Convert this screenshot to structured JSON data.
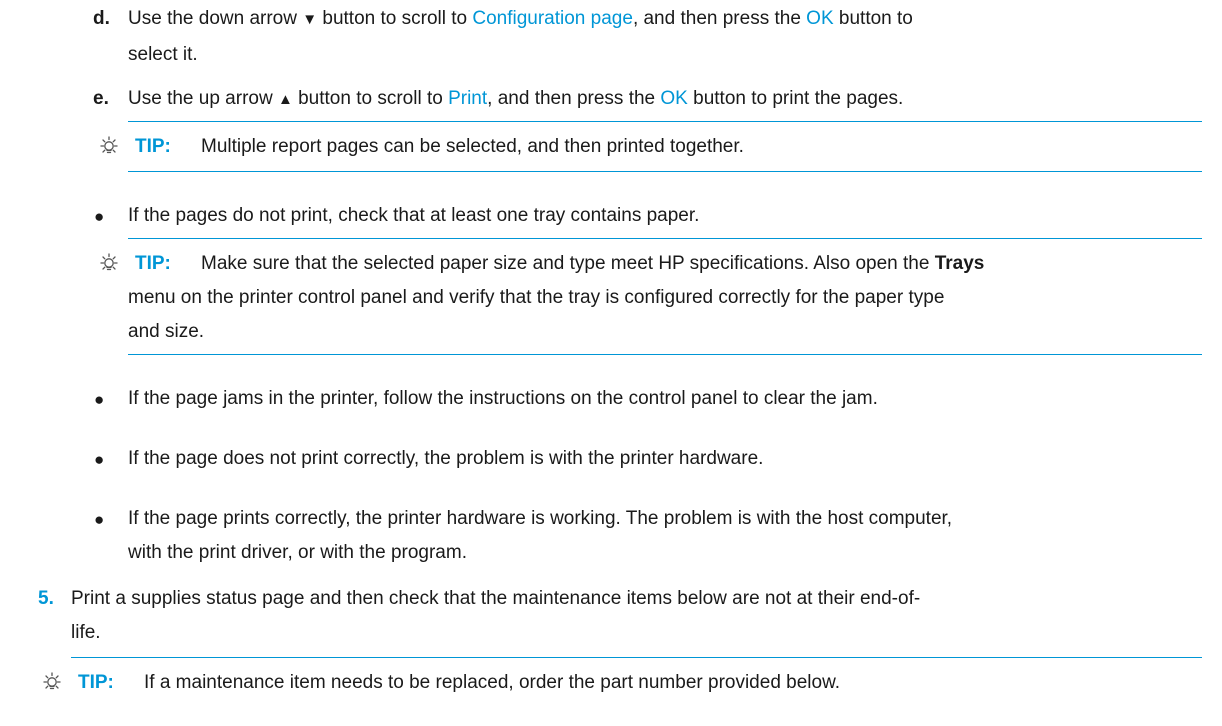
{
  "step_d": {
    "letter": "d.",
    "line1_a": "Use the down arrow ",
    "arrow": "▼",
    "line1_b": " button to scroll to ",
    "link1": "Configuration page",
    "line1_c": ", and then press the ",
    "link2": "OK",
    "line1_d": " button to",
    "line2": "select it."
  },
  "step_e": {
    "letter": "e.",
    "text_a": "Use the up arrow ",
    "arrow": "▲",
    "text_b": " button to scroll to ",
    "link1": "Print",
    "text_c": ", and then press the ",
    "link2": "OK",
    "text_d": " button to print the pages."
  },
  "tip1": {
    "label": "TIP:",
    "text": "Multiple report pages can be selected, and then printed together."
  },
  "bullet1": "If the pages do not print, check that at least one tray contains paper.",
  "tip2": {
    "label": "TIP:",
    "line1_a": "Make sure that the selected paper size and type meet HP specifications. Also open the ",
    "line1_bold": "Trays",
    "line2": "menu on the printer control panel and verify that the tray is configured correctly for the paper type",
    "line3": "and size."
  },
  "bullet2": "If the page jams in the printer, follow the instructions on the control panel to clear the jam.",
  "bullet3": "If the page does not print correctly, the problem is with the printer hardware.",
  "bullet4": {
    "line1": "If the page prints correctly, the printer hardware is working. The problem is with the host computer,",
    "line2": "with the print driver, or with the program."
  },
  "step5": {
    "number": "5.",
    "line1": "Print a supplies status page and then check that the maintenance items below are not at their end-of-",
    "line2": "life."
  },
  "tip3": {
    "label": "TIP:",
    "text": "If a maintenance item needs to be replaced, order the part number provided below."
  },
  "bullet_glyph": "●",
  "colors": {
    "accent": "#0096d6",
    "text": "#1a1a1a"
  },
  "icons": {
    "tip": "lightbulb-tip-icon"
  }
}
